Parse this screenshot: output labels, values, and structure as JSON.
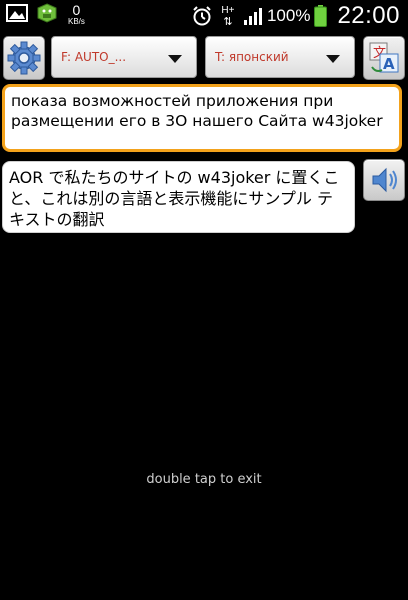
{
  "status_bar": {
    "speed_value": "0",
    "speed_unit": "KB/s",
    "network_type": "H+",
    "battery_percent": "100%",
    "time": "22:00",
    "icons": [
      "gallery-icon",
      "android-bug-icon",
      "alarm-icon",
      "data-arrows-icon",
      "signal-icon",
      "battery-icon"
    ]
  },
  "toolbar": {
    "settings_icon": "gear-icon",
    "from_language": "F: AUTO_...",
    "to_language": "T: японский",
    "translate_icon": "translate-icon",
    "spinner_text_color": "#c0392b"
  },
  "source_text": "показа возможностей приложения при размещении его в 3О нашего Сайта w43joker",
  "translated_text": "AOR で私たちのサイトの w43joker に置くこと、これは別の言語と表示機能にサンプル テキストの翻訳",
  "speaker_icon": "speaker-icon",
  "hint": "double tap to exit",
  "colors": {
    "background": "#000000",
    "source_border": "#f3a21b",
    "hint_text": "#cfcfcf"
  }
}
